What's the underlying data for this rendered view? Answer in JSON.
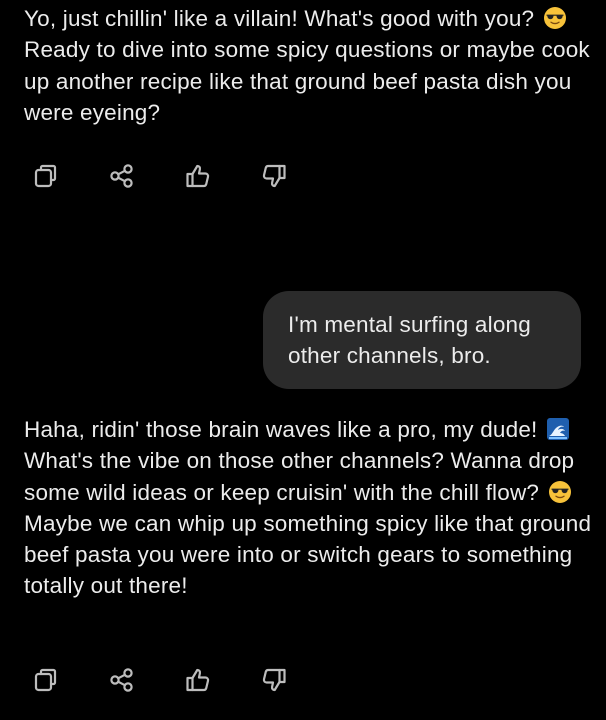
{
  "messages": [
    {
      "role": "assistant",
      "segments": [
        "Yo, just chillin' like a villain! What's good with you? ",
        " Ready to dive into some spicy questions or maybe cook up another recipe like that ground beef pasta dish you were eyeing?"
      ],
      "emojis": [
        "smiling-face-with-sunglasses"
      ]
    },
    {
      "role": "user",
      "text": "I'm mental surfing along other channels, bro."
    },
    {
      "role": "assistant",
      "segments": [
        "Haha, ridin' those brain waves like a pro, my dude! ",
        " What's the vibe on those other channels? Wanna drop some wild ideas or keep cruisin' with the chill flow? ",
        " Maybe we can whip up something spicy like that ground beef pasta you were into or switch gears to something totally out there!"
      ],
      "emojis": [
        "water-wave",
        "smiling-face-with-sunglasses"
      ]
    }
  ],
  "message_actions": [
    "copy-icon",
    "share-icon",
    "thumbs-up-icon",
    "thumbs-down-icon"
  ],
  "colors": {
    "background": "#000000",
    "text": "#ececec",
    "user_bubble": "#2b2b2b",
    "icon": "#bdbdbd"
  }
}
